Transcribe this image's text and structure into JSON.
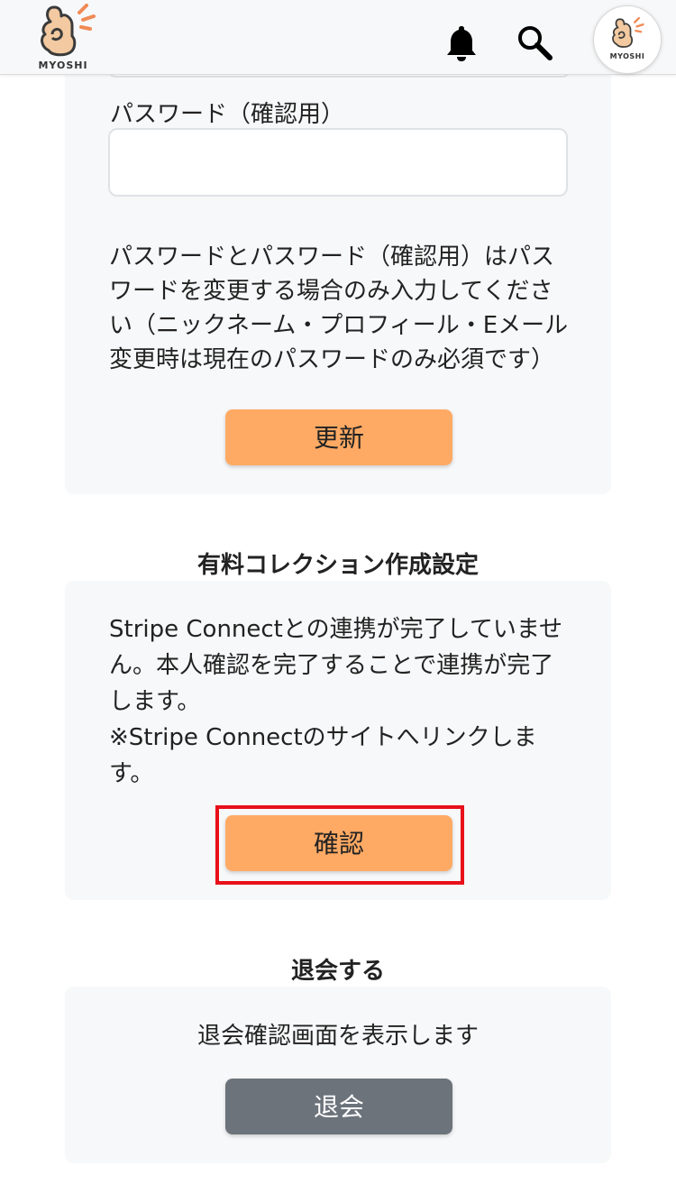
{
  "header": {
    "logo_text": "MYOSHI",
    "avatar_text": "MYOSHI",
    "icons": [
      "bell-icon",
      "search-icon"
    ]
  },
  "profile_form": {
    "password_confirm_label": "パスワード（確認用）",
    "password_confirm_value": "",
    "notice": "パスワードとパスワード（確認用）はパスワードを変更する場合のみ入力してください（ニックネーム・プロフィール・Eメール変更時は現在のパスワードのみ必須です）",
    "update_button": "更新"
  },
  "paid_collection": {
    "title": "有料コレクション作成設定",
    "message_lines": [
      "Stripe Connectとの連携が完了していません。本人確認を完了することで連携が完了します。",
      "※Stripe Connectのサイトへリンクします。"
    ],
    "confirm_button": "確認"
  },
  "withdraw": {
    "title": "退会する",
    "message": "退会確認画面を表示します",
    "withdraw_button": "退会"
  },
  "colors": {
    "accent_orange": "#ffaa64",
    "gray_button": "#6c737b",
    "highlight_red": "#e8101a",
    "card_bg": "#f7f8f9"
  }
}
